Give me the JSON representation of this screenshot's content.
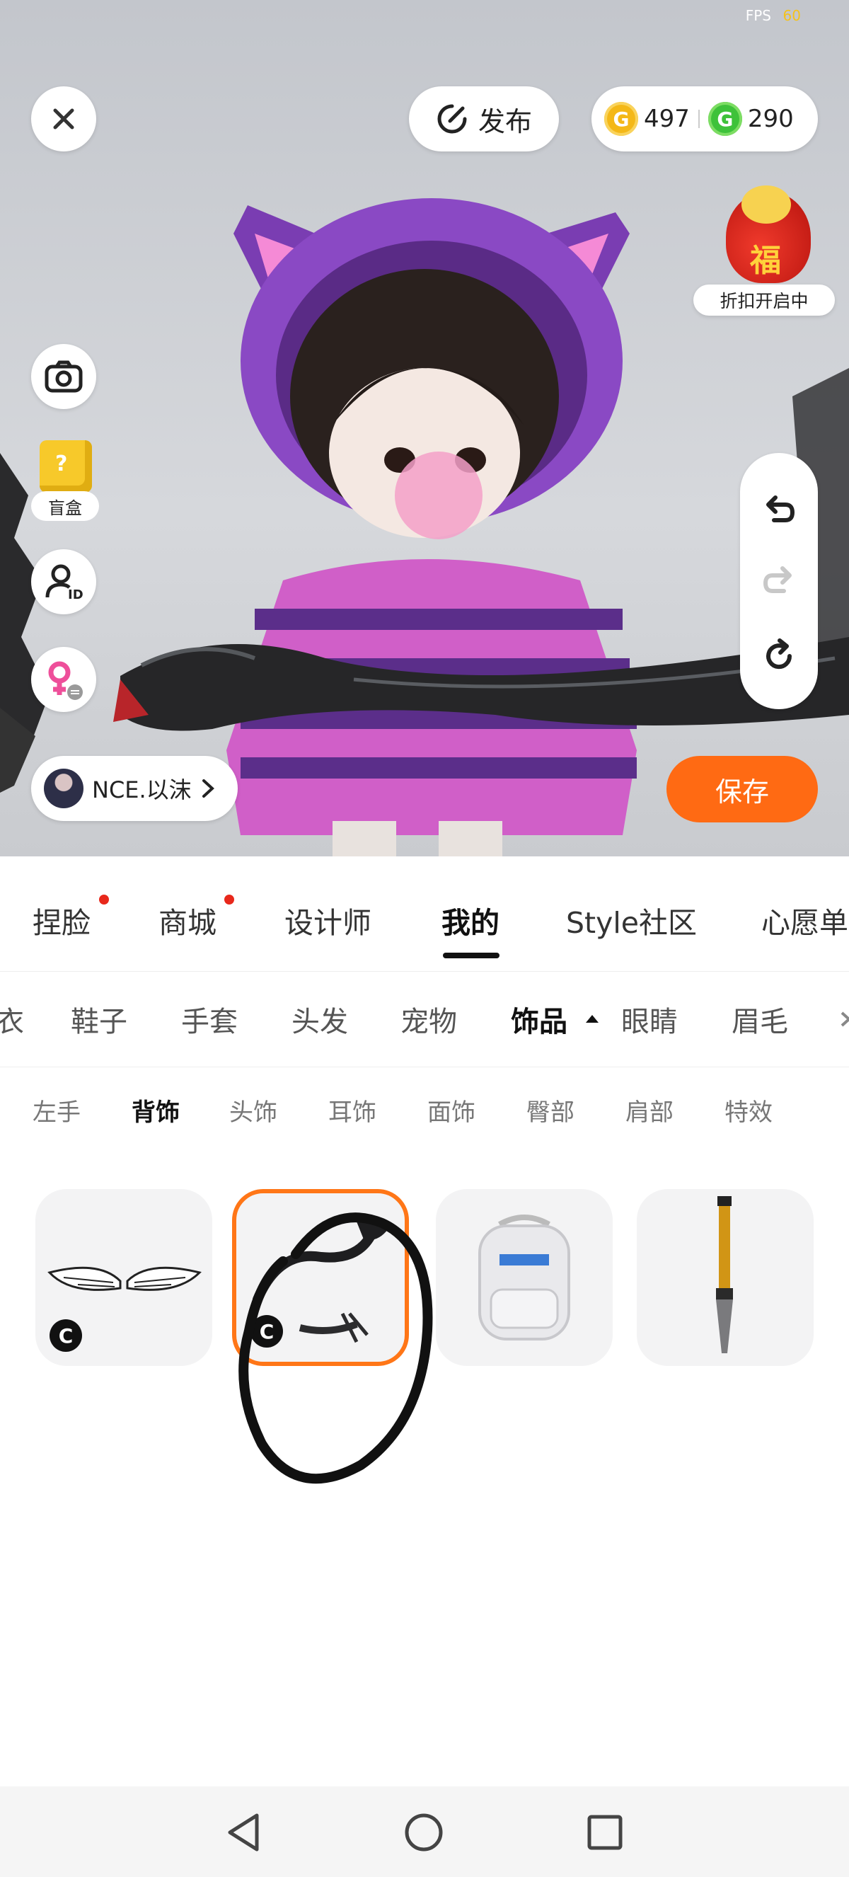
{
  "status": {
    "fps_label": "FPS",
    "fps_value": "60"
  },
  "header": {
    "publish_label": "发布"
  },
  "currency": {
    "gold_amount": "497",
    "green_amount": "290",
    "gold_symbol": "G",
    "green_symbol": "G"
  },
  "promo": {
    "label": "折扣开启中",
    "fu": "福"
  },
  "blind_box": {
    "label": "盲盒",
    "mark": "?"
  },
  "user": {
    "name": "NCE.以沫"
  },
  "save_label": "保存",
  "main_tabs": [
    "捏脸",
    "商城",
    "设计师",
    "我的",
    "Style社区",
    "心愿单"
  ],
  "category_tabs": [
    "衣",
    "鞋子",
    "手套",
    "头发",
    "宠物",
    "饰品",
    "眼睛",
    "眉毛"
  ],
  "sub_tabs": [
    "左手",
    "背饰",
    "头饰",
    "耳饰",
    "面饰",
    "臀部",
    "肩部",
    "特效"
  ],
  "items": [
    {
      "name": "wings",
      "badge": "C"
    },
    {
      "name": "black-dragon",
      "badge": "C"
    },
    {
      "name": "white-backpack"
    },
    {
      "name": "brush"
    }
  ],
  "colors": {
    "accent": "#ff6a13",
    "red_dot": "#e8281b",
    "selected_border": "#ff7617"
  },
  "icons": [
    "close-icon",
    "publish-icon",
    "camera-icon",
    "id-icon",
    "gender-switch-icon",
    "undo-icon",
    "redo-icon",
    "reset-icon",
    "chevron-right-icon",
    "caret-up-icon",
    "back-icon",
    "home-icon",
    "recents-icon"
  ]
}
